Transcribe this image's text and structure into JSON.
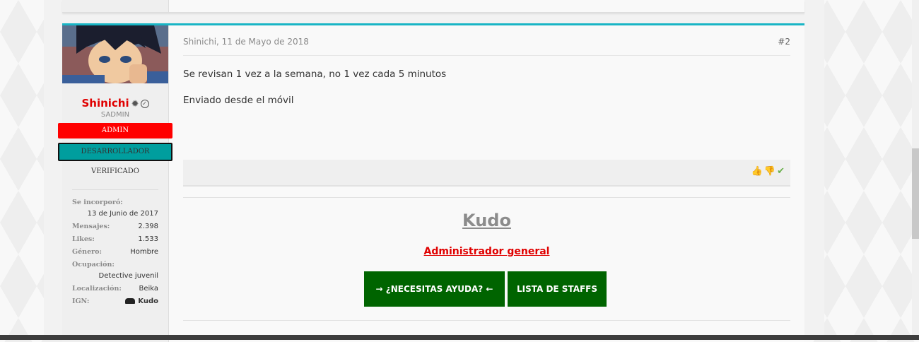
{
  "post": {
    "author": "Shinichi",
    "user_title": "SADMIN",
    "banners": {
      "admin": "ADMIN",
      "developer": "DESARROLLADOR",
      "verified": "VERIFICADO"
    },
    "extra": {
      "joined_label": "Se incorporó:",
      "joined_value": "13 de Junio de 2017",
      "messages_label": "Mensajes:",
      "messages_value": "2.398",
      "likes_label": "Likes:",
      "likes_value": "1.533",
      "gender_label": "Género:",
      "gender_value": "Hombre",
      "occupation_label": "Ocupación:",
      "occupation_value": "Detective juvenil",
      "location_label": "Localización:",
      "location_value": "Beika",
      "ign_label": "IGN:",
      "ign_value": "Kudo"
    },
    "date": "Shinichi, 11 de Mayo de 2018",
    "number": "#2",
    "message_line1": "Se revisan 1 vez a la semana, no 1 vez cada 5 minutos",
    "message_line2": "Enviado desde el móvil"
  },
  "signature": {
    "name": "Kudo",
    "role": "Administrador general",
    "help_button": "→ ¿NECESITAS AYUDA? ←",
    "staff_button": "LISTA DE STAFFS"
  },
  "colors": {
    "accent": "#19b5c5",
    "admin_red": "#ff0000",
    "developer_teal": "#009e9e",
    "button_green": "#006400"
  },
  "icons": [
    "like-icon",
    "dislike-icon",
    "check-icon",
    "staff-badge-icon",
    "verified-badge-icon"
  ]
}
